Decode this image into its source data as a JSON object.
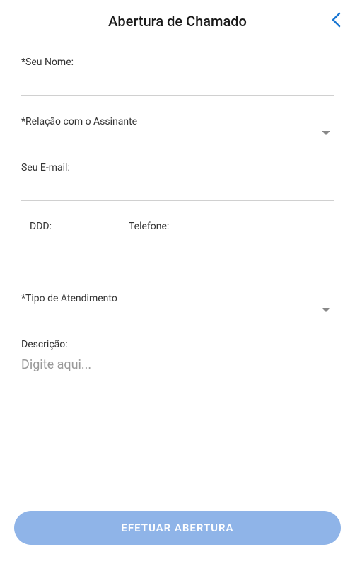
{
  "header": {
    "title": "Abertura de Chamado"
  },
  "form": {
    "name_label": "*Seu Nome:",
    "relation_label": "*Relação com o Assinante",
    "email_label": "Seu E-mail:",
    "ddd_label": "DDD:",
    "phone_label": "Telefone:",
    "service_type_label": "*Tipo de Atendimento",
    "description_label": "Descrição:",
    "description_placeholder": "Digite aqui...",
    "submit_label": "EFETUAR ABERTURA"
  }
}
